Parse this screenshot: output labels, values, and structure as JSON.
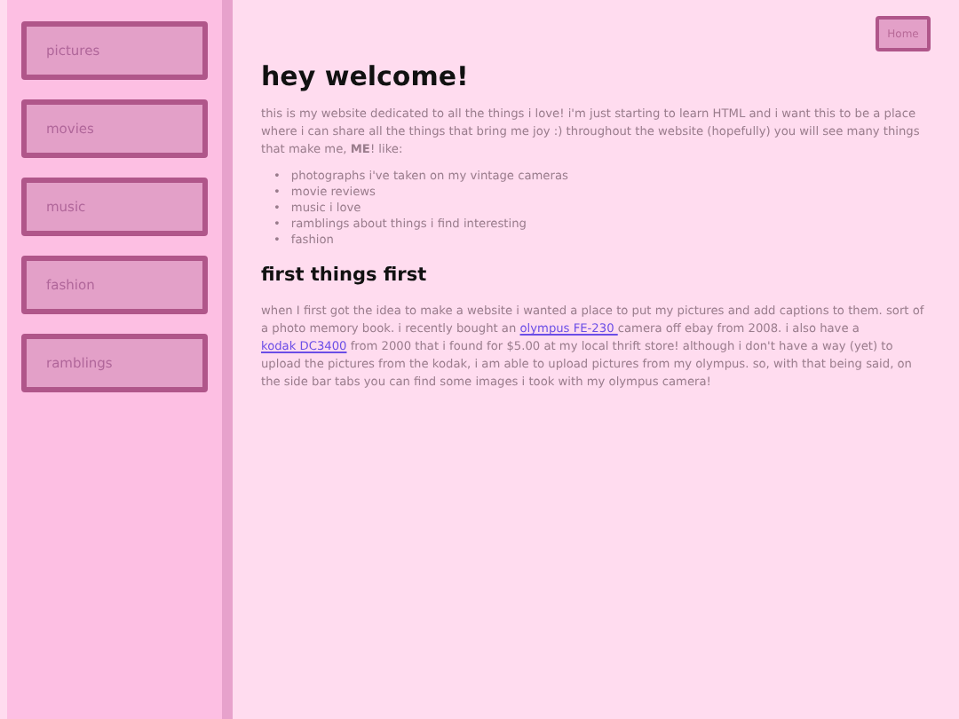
{
  "sidebar": {
    "items": [
      {
        "label": "pictures"
      },
      {
        "label": "movies"
      },
      {
        "label": "music"
      },
      {
        "label": "fashion"
      },
      {
        "label": "ramblings"
      }
    ]
  },
  "home_button": "Home",
  "heading": "hey welcome!",
  "intro": "this is my website dedicated to all the things i love! i'm just starting to learn HTML and i want this to be a place where i can share all the things that bring me joy :) throughout the website (hopefully) you will see many things that make me, **ME**! like:",
  "likes": [
    {
      "marker": "•",
      "text": "photographs i've taken on my vintage cameras"
    },
    {
      "marker": "•",
      "text": "movie reviews"
    },
    {
      "marker": "•",
      "text": "music i love"
    },
    {
      "marker": "•",
      "text": "ramblings about things i find interesting"
    },
    {
      "marker": "•",
      "text": "fashion"
    }
  ],
  "subheading": "first things first",
  "story": [
    {
      "kind": "text",
      "text": "when I first got the idea to make a website i wanted a place to put my pictures and add captions to them. sort of a photo memory book. i recently bought an "
    },
    {
      "kind": "link",
      "text": "olympus FE-230 "
    },
    {
      "kind": "text",
      "text": "camera off ebay from 2008. i also have a "
    },
    {
      "kind": "link",
      "text": "kodak DC3400"
    },
    {
      "kind": "text",
      "text": " from 2000 that i found for $5.00 at my local thrift store! although i don't have a way (yet) to upload the pictures from the kodak, i am able to upload pictures from my olympus. so, with that being said, on the side bar tabs you can find some images i took with my olympus camera!"
    }
  ]
}
